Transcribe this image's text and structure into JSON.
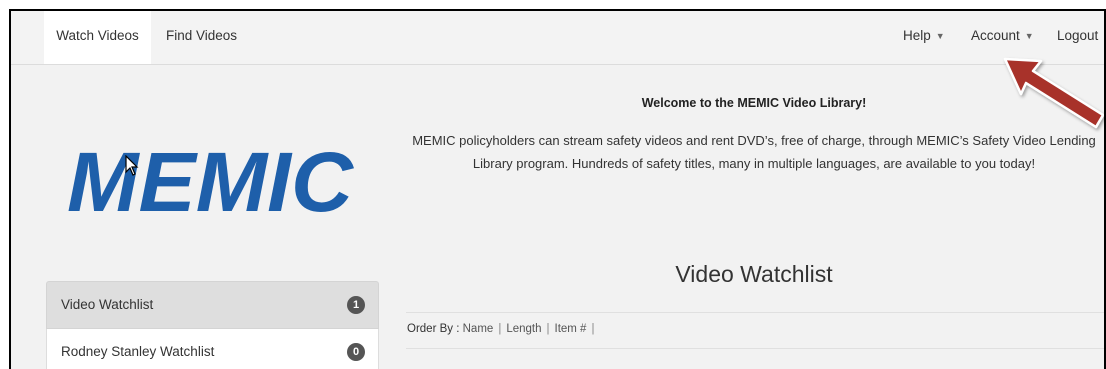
{
  "nav": {
    "watch_videos": "Watch Videos",
    "find_videos": "Find Videos",
    "help": "Help",
    "account": "Account",
    "logout": "Logout"
  },
  "logo_text": "MEMIC",
  "welcome": {
    "title": "Welcome to the MEMIC Video Library!",
    "line1": "MEMIC policyholders can stream safety videos and rent DVD’s, free of charge, through MEMIC’s Safety Video Lending",
    "line2": "Library program.  Hundreds of safety titles, many in multiple languages, are available to you today!"
  },
  "sidebar": {
    "items": [
      {
        "label": "Video Watchlist",
        "count": "1"
      },
      {
        "label": "Rodney Stanley Watchlist",
        "count": "0"
      }
    ]
  },
  "watchlist": {
    "title": "Video Watchlist",
    "order_by_label": "Order By",
    "order_colon": ":",
    "options": [
      "Name",
      "Length",
      "Item #"
    ]
  },
  "colors": {
    "logo_blue": "#1e5faa",
    "arrow_red": "#a8302a",
    "badge": "#555555"
  }
}
